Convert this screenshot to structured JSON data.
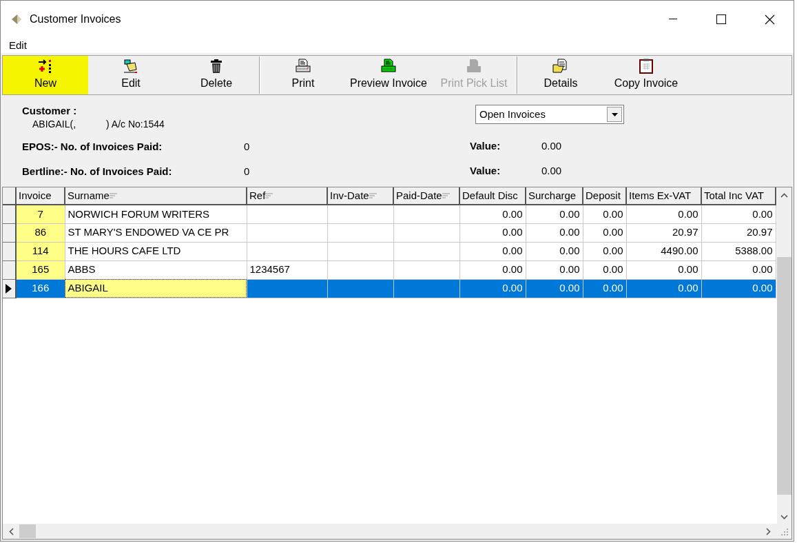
{
  "window": {
    "title": "Customer Invoices"
  },
  "menu": [
    "Edit"
  ],
  "toolbar": [
    {
      "label": "New",
      "highlighted": true,
      "disabled": false,
      "separator_before": false
    },
    {
      "label": "Edit",
      "highlighted": false,
      "disabled": false,
      "separator_before": false
    },
    {
      "label": "Delete",
      "highlighted": false,
      "disabled": false,
      "separator_before": false
    },
    {
      "label": "Print",
      "highlighted": false,
      "disabled": false,
      "separator_before": true
    },
    {
      "label": "Preview Invoice",
      "highlighted": false,
      "disabled": false,
      "separator_before": false
    },
    {
      "label": "Print Pick List",
      "highlighted": false,
      "disabled": true,
      "separator_before": false
    },
    {
      "label": "Details",
      "highlighted": false,
      "disabled": false,
      "separator_before": true
    },
    {
      "label": "Copy Invoice",
      "highlighted": false,
      "disabled": false,
      "separator_before": false
    }
  ],
  "customer": {
    "label": "Customer :",
    "name": "ABIGAIL(,",
    "account": ") A/c No:1544"
  },
  "filter_dropdown": {
    "value": "Open Invoices"
  },
  "stats": [
    {
      "label": "EPOS:- No. of Invoices Paid:",
      "count": "0",
      "value_label": "Value:",
      "value": "0.00"
    },
    {
      "label": "Bertline:- No. of Invoices Paid:",
      "count": "0",
      "value_label": "Value:",
      "value": "0.00"
    }
  ],
  "table": {
    "columns": [
      {
        "label": "Invoice",
        "kind": "id",
        "filter": false
      },
      {
        "label": "Surname",
        "kind": "text",
        "filter": true
      },
      {
        "label": "Ref",
        "kind": "text",
        "filter": true
      },
      {
        "label": "Inv-Date",
        "kind": "text",
        "filter": true
      },
      {
        "label": "Paid-Date",
        "kind": "text",
        "filter": true
      },
      {
        "label": "Default Disc",
        "kind": "number",
        "filter": false
      },
      {
        "label": "Surcharge",
        "kind": "number",
        "filter": false
      },
      {
        "label": "Deposit",
        "kind": "number",
        "filter": false
      },
      {
        "label": "Items Ex-VAT",
        "kind": "number",
        "filter": false
      },
      {
        "label": "Total Inc VAT",
        "kind": "number",
        "filter": false
      }
    ],
    "rows": [
      {
        "selected": false,
        "cells": [
          "7",
          "NORWICH FORUM WRITERS",
          "",
          "",
          "",
          "0.00",
          "0.00",
          "0.00",
          "0.00",
          "0.00"
        ]
      },
      {
        "selected": false,
        "cells": [
          "86",
          "ST MARY'S ENDOWED VA CE PR",
          "",
          "",
          "",
          "0.00",
          "0.00",
          "0.00",
          "20.97",
          "20.97"
        ]
      },
      {
        "selected": false,
        "cells": [
          "114",
          "THE HOURS CAFE LTD",
          "",
          "",
          "",
          "0.00",
          "0.00",
          "0.00",
          "4490.00",
          "5388.00"
        ]
      },
      {
        "selected": false,
        "cells": [
          "165",
          "ABBS",
          "1234567",
          "",
          "",
          "0.00",
          "0.00",
          "0.00",
          "0.00",
          "0.00"
        ]
      },
      {
        "selected": true,
        "cells": [
          "166",
          "ABIGAIL",
          "",
          "",
          "",
          "0.00",
          "0.00",
          "0.00",
          "0.00",
          "0.00"
        ]
      }
    ]
  }
}
